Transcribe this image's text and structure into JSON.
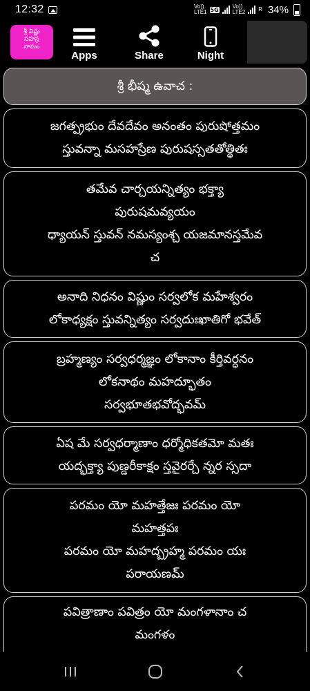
{
  "status_bar": {
    "time": "12:32",
    "sim1_label": "Vo))\nLTE1",
    "network_type": "5G",
    "sim2_label": "Vo))\nLTE2",
    "sim2_extra": "R",
    "battery": "34%"
  },
  "app_bar": {
    "logo_text": "శ్రీ విష్ణు\nసహస్ర\nనామం",
    "apps_label": "Apps",
    "share_label": "Share",
    "night_label": "Night"
  },
  "heading": "శ్రీ భీష్మ ఉవాచ :",
  "verses": [
    "జగత్ప్రభుం దేవదేవం అనంతం పురుషోత్తమం\nస్తువన్నా మసహస్రేణ పురుషస్సతతోత్థితః",
    "తమేవ చార్చయన్నిత్యం భక్త్యా\nపురుషమవ్యయం\nధ్యాయన్ స్తువన్ నమస్యంశ్చ యజమానస్తమేవ\nచ",
    "అనాది నిధనం విష్ణుం సర్వలోక మహేశ్వరం\nలోకాధ్యక్షం స్తువన్నిత్యం సర్వదుఃఖాతిగో భవేత్",
    "బ్రహ్మణ్యం సర్వధర్మజ్ఞం లోకానాం కీర్తివర్ధనం\nలోకనాథం మహద్భూతం\nసర్వభూతభవోద్భవమ్",
    "ఏష మే సర్వధర్మాణాం ధర్మోధికతమో మతః\nయద్భక్త్యా పుణ్డరీకాక్షం స్తవైరర్చే న్నర స్సదా",
    "పరమం యో మహత్తేజః పరమం యో\nమహత్తపః\nపరమం యో మహద్బ్రహ్మ పరమం యః\nపరాయణమ్",
    "పవిత్రాణాం పవిత్రం యో మంగళానాం చ\nమంగళం"
  ]
}
